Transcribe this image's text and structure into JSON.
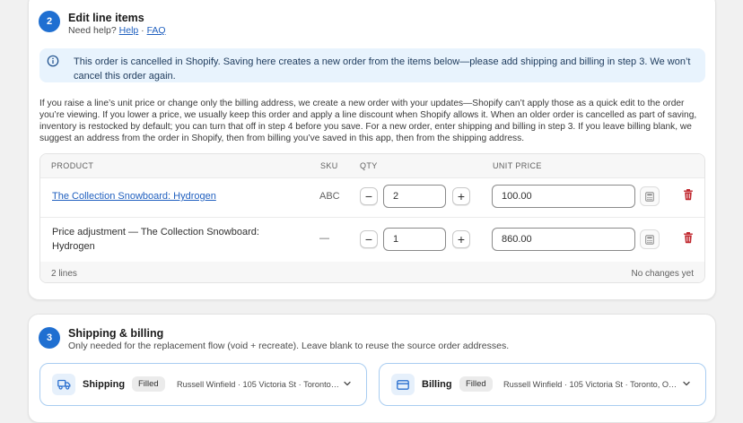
{
  "section2": {
    "step": "2",
    "title": "Edit line items",
    "help_prefix": "Need help?",
    "help_link": "Help",
    "separator": "·",
    "faq_link": "FAQ"
  },
  "banner": {
    "text": "This order is cancelled in Shopify. Saving here creates a new order from the items below—please add shipping and billing in step 3. We won’t cancel this order again."
  },
  "paragraph": "If you raise a line’s unit price or change only the billing address, we create a new order with your updates—Shopify can’t apply those as a quick edit to the order you’re viewing. If you lower a price, we usually keep this order and apply a line discount when Shopify allows it. When an older order is cancelled as part of saving, inventory is restocked by default; you can turn that off in step 4 before you save. For a new order, enter shipping and billing in step 3. If you leave billing blank, we suggest an address from the order in Shopify, then from billing you’ve saved in this app, then from the shipping address.",
  "table": {
    "headers": {
      "product": "PRODUCT",
      "sku": "SKU",
      "qty": "QTY",
      "unit_price": "UNIT PRICE"
    },
    "rows": [
      {
        "product": "The Collection Snowboard: Hydrogen",
        "sku": "ABC",
        "qty": "2",
        "price": "100.00"
      },
      {
        "product_line1": "Price adjustment — The Collection Snowboard:",
        "product_line2": "Hydrogen",
        "sku": "—",
        "qty": "1",
        "price": "860.00"
      }
    ],
    "footer_left": "2 lines",
    "footer_right": "No changes yet",
    "minus": "−",
    "plus": "+"
  },
  "section3": {
    "step": "3",
    "title": "Shipping & billing",
    "subtitle": "Only needed for the replacement flow (void + recreate). Leave blank to reuse the source order addresses.",
    "shipping": {
      "title": "Shipping",
      "badge": "Filled",
      "summary": "Russell Winfield · 105 Victoria St · Toronto…"
    },
    "billing": {
      "title": "Billing",
      "badge": "Filled",
      "summary": "Russell Winfield · 105 Victoria St · Toronto, O…"
    }
  },
  "colors": {
    "accent": "#1f6fd1",
    "link": "#1f5fbf",
    "banner_bg": "#e8f3fd",
    "danger": "#c0262d"
  },
  "icons": [
    "info-icon",
    "calculator-icon",
    "trash-icon",
    "truck-icon",
    "credit-card-icon",
    "chevron-down-icon"
  ]
}
